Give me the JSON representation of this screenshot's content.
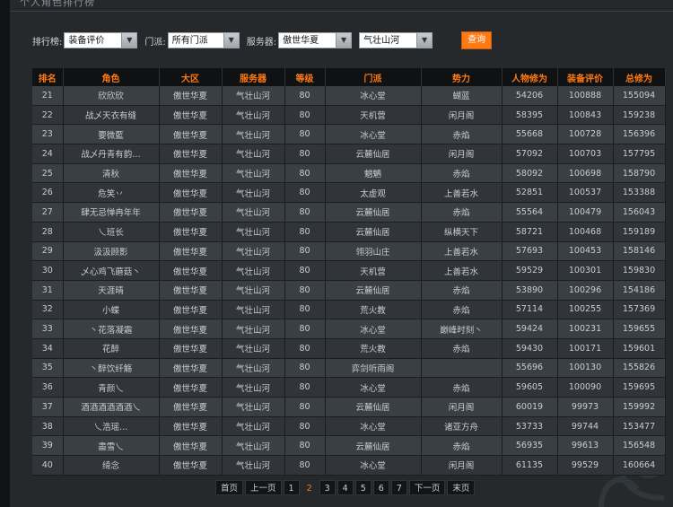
{
  "header": {
    "title": "个人角色排行榜"
  },
  "filters": {
    "rank_label": "排行榜:",
    "rank_value": "装备评价",
    "sect_label": "门派:",
    "sect_value": "所有门派",
    "server_label": "服务器:",
    "zone_value": "傲世华夏",
    "server_value": "气壮山河",
    "search_label": "查询"
  },
  "table": {
    "columns": [
      "排名",
      "角色",
      "大区",
      "服务器",
      "等级",
      "门派",
      "势力",
      "人物修为",
      "装备评价",
      "总修为"
    ],
    "rows": [
      [
        "21",
        "欣欣欣",
        "傲世华夏",
        "气壮山河",
        "80",
        "冰心堂",
        "蝴蓝",
        "54206",
        "100888",
        "155094"
      ],
      [
        "22",
        "战乄天衣有缝",
        "傲世华夏",
        "气壮山河",
        "80",
        "天机营",
        "闲月阁",
        "58395",
        "100843",
        "159238"
      ],
      [
        "23",
        "要微藍",
        "傲世华夏",
        "气壮山河",
        "80",
        "冰心堂",
        "赤焰",
        "55668",
        "100728",
        "156396"
      ],
      [
        "24",
        "战乄丹青有韵…",
        "傲世华夏",
        "气壮山河",
        "80",
        "云麓仙居",
        "闲月阁",
        "57092",
        "100703",
        "157795"
      ],
      [
        "25",
        "清秋",
        "傲世华夏",
        "气壮山河",
        "80",
        "魍魉",
        "赤焰",
        "58092",
        "100698",
        "158790"
      ],
      [
        "26",
        "危笑丷",
        "傲世华夏",
        "气壮山河",
        "80",
        "太虚观",
        "上善若水",
        "52851",
        "100537",
        "153388"
      ],
      [
        "27",
        "肆无忌惮冉年年",
        "傲世华夏",
        "气壮山河",
        "80",
        "云麓仙居",
        "赤焰",
        "55564",
        "100479",
        "156043"
      ],
      [
        "28",
        "乀班长",
        "傲世华夏",
        "气壮山河",
        "80",
        "云麓仙居",
        "纵横天下",
        "58721",
        "100468",
        "159189"
      ],
      [
        "29",
        "汲汲顾影",
        "傲世华夏",
        "气壮山河",
        "80",
        "翎羽山庄",
        "上善若水",
        "57693",
        "100453",
        "158146"
      ],
      [
        "30",
        "乄心鸡飞蘑菇丶",
        "傲世华夏",
        "气壮山河",
        "80",
        "天机营",
        "上善若水",
        "59529",
        "100301",
        "159830"
      ],
      [
        "31",
        "天涯晴",
        "傲世华夏",
        "气壮山河",
        "80",
        "云麓仙居",
        "赤焰",
        "53890",
        "100296",
        "154186"
      ],
      [
        "32",
        "小蝶",
        "傲世华夏",
        "气壮山河",
        "80",
        "荒火教",
        "赤焰",
        "57114",
        "100255",
        "157369"
      ],
      [
        "33",
        "丶花落凝霜",
        "傲世华夏",
        "气壮山河",
        "80",
        "冰心堂",
        "巅峰时刻丶",
        "59424",
        "100231",
        "159655"
      ],
      [
        "34",
        "花醉",
        "傲世华夏",
        "气壮山河",
        "80",
        "荒火教",
        "赤焰",
        "59430",
        "100171",
        "159601"
      ],
      [
        "35",
        "丶醉饮纤觞",
        "傲世华夏",
        "气壮山河",
        "80",
        "弈剑听雨阁",
        "",
        "55696",
        "100130",
        "155826"
      ],
      [
        "36",
        "青颜乀",
        "傲世华夏",
        "气壮山河",
        "80",
        "冰心堂",
        "赤焰",
        "59605",
        "100090",
        "159695"
      ],
      [
        "37",
        "酒酒酒酒酒酒乀",
        "傲世华夏",
        "气壮山河",
        "80",
        "云麓仙居",
        "闲月阁",
        "60019",
        "99973",
        "159992"
      ],
      [
        "38",
        "乀浩瑶…",
        "傲世华夏",
        "气壮山河",
        "80",
        "冰心堂",
        "诸亚方舟",
        "53733",
        "99744",
        "153477"
      ],
      [
        "39",
        "盡雪乀",
        "傲世华夏",
        "气壮山河",
        "80",
        "云麓仙居",
        "赤焰",
        "56935",
        "99613",
        "156548"
      ],
      [
        "40",
        "绮念",
        "傲世华夏",
        "气壮山河",
        "80",
        "冰心堂",
        "闲月阁",
        "61135",
        "99529",
        "160664"
      ]
    ]
  },
  "pager": {
    "first": "首页",
    "prev": "上一页",
    "pages": [
      "1",
      "2",
      "3",
      "4",
      "5",
      "6",
      "7"
    ],
    "current": "2",
    "next": "下一页",
    "last": "末页"
  },
  "colors": {
    "accent": "#ff7a14",
    "row_odd": "#3a3f43",
    "row_even": "#313539",
    "header_bg": "#0f1112"
  }
}
